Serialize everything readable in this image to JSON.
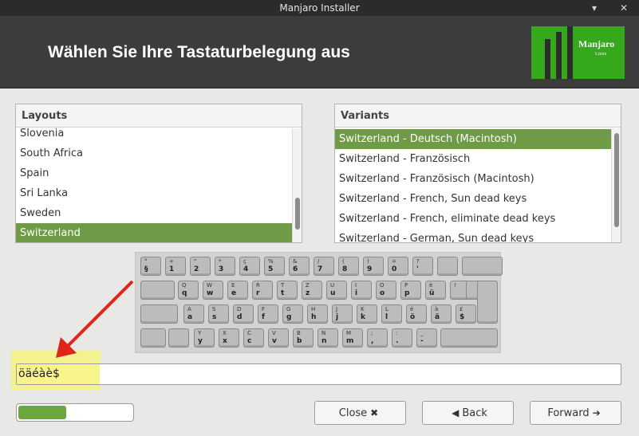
{
  "window": {
    "title": "Manjaro Installer",
    "minimize_glyph": "▾",
    "close_glyph": "✕"
  },
  "header": {
    "heading": "Wählen Sie Ihre Tastaturbelegung aus",
    "logo_name": "Manjaro",
    "logo_sub": "Linux"
  },
  "layouts": {
    "header": "Layouts",
    "items": [
      "Slovenia",
      "South Africa",
      "Spain",
      "Sri Lanka",
      "Sweden",
      "Switzerland"
    ],
    "selected": "Switzerland"
  },
  "variants": {
    "header": "Variants",
    "items": [
      "Switzerland - Deutsch (Macintosh)",
      "Switzerland - Französisch",
      "Switzerland - Französisch (Macintosh)",
      "Switzerland - French, Sun dead keys",
      "Switzerland - French, eliminate dead keys",
      "Switzerland - German, Sun dead keys"
    ],
    "selected": "Switzerland - Deutsch (Macintosh)"
  },
  "keyboard": {
    "row1": [
      [
        "°",
        "§"
      ],
      [
        "+",
        "1"
      ],
      [
        "\"",
        "2"
      ],
      [
        "*",
        "3"
      ],
      [
        "ç",
        "4"
      ],
      [
        "%",
        "5"
      ],
      [
        "&",
        "6"
      ],
      [
        "/",
        "7"
      ],
      [
        "(",
        "8"
      ],
      [
        ")",
        "9"
      ],
      [
        "=",
        "0"
      ],
      [
        "?",
        "'"
      ],
      [
        "",
        ""
      ]
    ],
    "row2": [
      [
        "Q",
        "q"
      ],
      [
        "W",
        "w"
      ],
      [
        "E",
        "e"
      ],
      [
        "R",
        "r"
      ],
      [
        "T",
        "t"
      ],
      [
        "Z",
        "z"
      ],
      [
        "U",
        "u"
      ],
      [
        "I",
        "i"
      ],
      [
        "O",
        "o"
      ],
      [
        "P",
        "p"
      ],
      [
        "è",
        "ü"
      ],
      [
        "!",
        ""
      ]
    ],
    "row3": [
      [
        "A",
        "a"
      ],
      [
        "S",
        "s"
      ],
      [
        "D",
        "d"
      ],
      [
        "F",
        "f"
      ],
      [
        "G",
        "g"
      ],
      [
        "H",
        "h"
      ],
      [
        "J",
        "j"
      ],
      [
        "K",
        "k"
      ],
      [
        "L",
        "l"
      ],
      [
        "é",
        "ö"
      ],
      [
        "à",
        "ä"
      ],
      [
        "£",
        "$"
      ]
    ],
    "row4": [
      [
        "Y",
        "y"
      ],
      [
        "X",
        "x"
      ],
      [
        "C",
        "c"
      ],
      [
        "V",
        "v"
      ],
      [
        "B",
        "b"
      ],
      [
        "N",
        "n"
      ],
      [
        "M",
        "m"
      ],
      [
        ";",
        ","
      ],
      [
        ":",
        "."
      ],
      [
        "_",
        "-"
      ]
    ]
  },
  "test_field": {
    "value": "öäéàè$"
  },
  "progress": {
    "fraction": 0.42
  },
  "buttons": {
    "close": {
      "label": "Close",
      "icon": "✖"
    },
    "back": {
      "label": "Back",
      "icon": "◀"
    },
    "forward": {
      "label": "Forward",
      "icon": "➔"
    }
  },
  "colors": {
    "accent": "#6f9b47",
    "header_bg": "#3c3c3c",
    "logo_green": "#35a81c",
    "highlight": "#f4f380",
    "arrow": "#e02418"
  }
}
